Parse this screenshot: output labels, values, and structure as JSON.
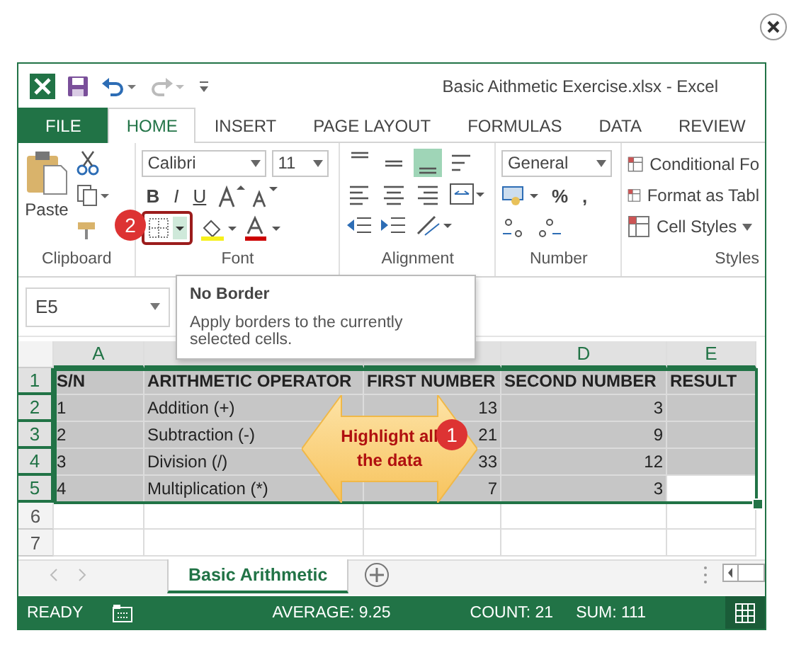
{
  "window": {
    "title": "Basic Aithmetic Exercise.xlsx - Excel"
  },
  "ribbon_tabs": [
    {
      "label": "FILE",
      "kind": "file",
      "selected": false
    },
    {
      "label": "HOME",
      "kind": "tab",
      "selected": true
    },
    {
      "label": "INSERT",
      "kind": "tab",
      "selected": false
    },
    {
      "label": "PAGE LAYOUT",
      "kind": "tab",
      "selected": false
    },
    {
      "label": "FORMULAS",
      "kind": "tab",
      "selected": false
    },
    {
      "label": "DATA",
      "kind": "tab",
      "selected": false
    },
    {
      "label": "REVIEW",
      "kind": "tab",
      "selected": false
    }
  ],
  "ribbon": {
    "paste": "Paste",
    "font_name": "Calibri",
    "font_size": "11",
    "bold": "B",
    "italic": "I",
    "underline": "U",
    "number_format": "General",
    "percent": "%",
    "comma": ",",
    "align_buttons": [
      {
        "kind": "top",
        "selected": false
      },
      {
        "kind": "middle",
        "selected": false
      },
      {
        "kind": "bottom",
        "selected": true
      }
    ],
    "styles": [
      "Conditional Fo",
      "Format as Tabl",
      "Cell Styles"
    ],
    "groups": [
      "Clipboard",
      "Font",
      "Alignment",
      "Number",
      "Styles"
    ],
    "step": "2"
  },
  "tooltip": {
    "title": "No Border",
    "text": "Apply borders to the currently selected cells."
  },
  "name_box": "E5",
  "sheet": {
    "columns": [
      {
        "label": "A"
      },
      {},
      {},
      {
        "label": "D"
      },
      {
        "label": "E"
      }
    ],
    "rows": [
      {
        "number": "1",
        "selected": true,
        "cells": [
          "S/N",
          "ARITHMETIC OPERATOR",
          "FIRST NUMBER",
          "SECOND NUMBER",
          "RESULT"
        ]
      },
      {
        "number": "2",
        "selected": true,
        "cells": [
          "1",
          "Addition (+)",
          "13",
          "3"
        ]
      },
      {
        "number": "3",
        "selected": true,
        "cells": [
          "2",
          "Subtraction (-)",
          "21",
          "9"
        ]
      },
      {
        "number": "4",
        "selected": true,
        "cells": [
          "3",
          "Division (/)",
          "33",
          "12"
        ]
      },
      {
        "number": "5",
        "selected": true,
        "cells": [
          "4",
          "Multiplication (*)",
          "7",
          "3",
          {
            "active": true
          }
        ]
      },
      {
        "number": "6",
        "selected": false
      },
      {
        "number": "7",
        "selected": false
      }
    ]
  },
  "callout": {
    "text": "Highlight all the data",
    "step": "1"
  },
  "sheet_tabs": [
    {
      "label": "Basic Arithmetic",
      "selected": true
    }
  ],
  "status_bar": {
    "mode": "READY",
    "average": "AVERAGE: 9.25",
    "count": "COUNT: 21",
    "sum": "SUM: 111"
  }
}
